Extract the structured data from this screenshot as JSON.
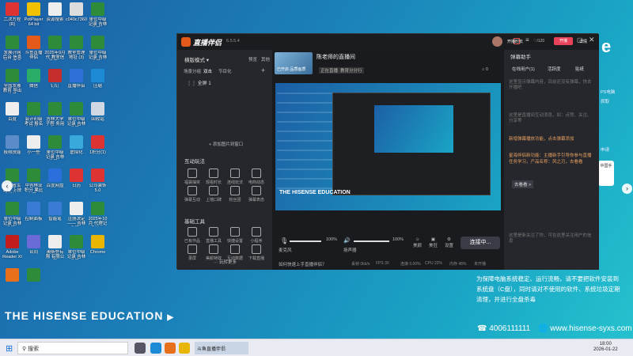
{
  "desktop_icons": [
    {
      "label": "二次方程(R)",
      "color": "#d33"
    },
    {
      "label": "PotPlayer 64 bit",
      "color": "#f2c200"
    },
    {
      "label": "资源搜索",
      "color": "#eee"
    },
    {
      "label": "c040c7360...",
      "color": "#ddd"
    },
    {
      "label": "单位中级记录 吉林省显...",
      "color": "#2e8b3a"
    },
    {
      "label": "发展计网后台 信息录入模板",
      "color": "#2e8b3a"
    },
    {
      "label": "斗鱼直播伴侣",
      "color": "#e35a1a"
    },
    {
      "label": "2025年9月代 教室信息表...",
      "color": "#2e8b3a"
    },
    {
      "label": "教室管理地址 (3)",
      "color": "#2e8b3a"
    },
    {
      "label": "单位中级记录 吉林省显...",
      "color": "#2e8b3a"
    },
    {
      "label": "全国发展教育 导出结果",
      "color": "#2e8b3a"
    },
    {
      "label": "微信",
      "color": "#2aae67"
    },
    {
      "label": "钉钉",
      "color": "#c52d2d"
    },
    {
      "label": "直播伴侣",
      "color": "#2f6fd8"
    },
    {
      "label": "压缩",
      "color": "#1d8ad6"
    },
    {
      "label": "百度",
      "color": "#eee"
    },
    {
      "label": "会计初级考试 报名地址",
      "color": "#2e8b3a"
    },
    {
      "label": "吉林大学子程 务用（RE...",
      "color": "#2e8b3a"
    },
    {
      "label": "单位中级记录 吉林省显...",
      "color": "#2e8b3a"
    },
    {
      "label": "回收站",
      "color": "#cfd8e3"
    },
    {
      "label": "极限技能",
      "color": "#5b8cc9"
    },
    {
      "label": "小一些",
      "color": "#eee"
    },
    {
      "label": "单位中级记录 吉林省显...",
      "color": "#2e8b3a"
    },
    {
      "label": "虚拟化",
      "color": "#39a9dc"
    },
    {
      "label": "1积分(1)",
      "color": "#d33"
    },
    {
      "label": "吉林省军教业 上技术标的...",
      "color": "#2e8b3a"
    },
    {
      "label": "中吉林业积分 果比上课...",
      "color": "#2e8b3a"
    },
    {
      "label": "百度网盘",
      "color": "#2a6fdb"
    },
    {
      "label": "日历",
      "color": "#d33"
    },
    {
      "label": "公司装饰 5.0",
      "color": "#d33"
    },
    {
      "label": "单位中级记录 吉林省显...",
      "color": "#2e8b3a"
    },
    {
      "label": "控制面板",
      "color": "#3a7bd5"
    },
    {
      "label": "智能笔",
      "color": "#3a7bd5"
    },
    {
      "label": "注册决定—— 吉林省显...",
      "color": "#eee"
    },
    {
      "label": "2025年10月 代理记账的...",
      "color": "#2e8b3a"
    },
    {
      "label": "Adobe Reader XI",
      "color": "#c21d1d"
    },
    {
      "label": "合同",
      "color": "#6b6bd8"
    },
    {
      "label": "澳斯登有限 有限公司",
      "color": "#eee"
    },
    {
      "label": "单位中级记录 吉林省显...",
      "color": "#2e8b3a"
    },
    {
      "label": "Chrome",
      "color": "#e8b500"
    },
    {
      "label": "",
      "color": "#e8701a"
    },
    {
      "label": "",
      "color": "#2e8b3a"
    }
  ],
  "desktop_brand": "THE HISENSE EDUCATION",
  "app": {
    "logo": "直播伴侣",
    "version": "6.5.5.4",
    "scene_mode": "横版模式",
    "preview": "预览",
    "other": "其他",
    "scene_tabs": [
      "场景分组",
      "双击",
      "节目化"
    ],
    "scene_item": "全屏 1",
    "add_source": "+ 添加图片到窗口",
    "interactive_title": "互动玩法",
    "interactive_tools": [
      "福袋抽奖",
      "观看时长",
      "连线玩法",
      "电商动态",
      "弹幕互动",
      "上墙口碑",
      "粉丝团",
      "弹幕表态"
    ],
    "basic_title": "基础工具",
    "basic_tools": [
      "已有作品",
      "直播工具",
      "快捷设置",
      "小程序",
      "录屏",
      "美颜特效",
      "互动数据",
      "下载直播"
    ],
    "more_tools": "··· 玩转更多",
    "stream_title": "陈老师的直播间",
    "stream_tag": "已开启 品质画质",
    "cat1": "正在直播",
    "cat2": "教育分分行",
    "screen_text": "THE HISENSE EDUCATION",
    "mic_label": "麦克风",
    "mic_val": "100%",
    "spk_label": "扬声器",
    "spk_val": "100%",
    "beauty": "美颜",
    "effects": "美狂",
    "settings": "设置",
    "connect_btn": "连接中...",
    "status_left": "如何快速上手直播伴侣？",
    "stats": [
      "丢帧 0kb/s",
      "FPS 30",
      "连接 0.00%",
      "CPU 22%",
      "内存 48%",
      "未开播"
    ],
    "top_icons": [
      "开播助手",
      "120",
      "开播",
      "详情"
    ],
    "top_right_label": "开播时长",
    "viewer_count": "120",
    "gift_count": "0",
    "right_title": "弹幕助手",
    "right_tabs": [
      "在线用户(1)",
      "活跃度",
      "贴纸"
    ],
    "chat_placeholder": "这里显示弹幕内容，目前还没有弹幕，快去开播吧",
    "chat_note": "这里是直播间互动消息，如：点赞、关注、分享等",
    "notice": "新增弹幕播放功能，点击弹幕添加",
    "promo": "星海伴侣新功能：主播新手引导你参与直播任务学习，产品名称：风之刃，去看看",
    "promo_link": "去看看 >",
    "footer_note": "这里是新关注了你，可在这里关注用户的信息"
  },
  "info_panel": {
    "text": "为保障电脑系统稳定、运行流畅，请不要把软件安装到系统盘（C盘），同时请对不使用的软件、系统垃圾定期清理，并进行全盘杀毒",
    "phone": "4006111111",
    "website": "www.hisense-syxs.com",
    "right_labels": [
      "PS电脑",
      "抓取",
      "申请"
    ]
  },
  "taskbar": {
    "search": "搜索",
    "time": "18:00",
    "date": "2026-01-22",
    "app_label": "斗鱼直播伴侣"
  },
  "helper_widget": {
    "label": "中国手"
  },
  "colors": {
    "accent": "#e8435a",
    "connect": "#3a3b44",
    "brand_teal": "#25c2cf"
  }
}
